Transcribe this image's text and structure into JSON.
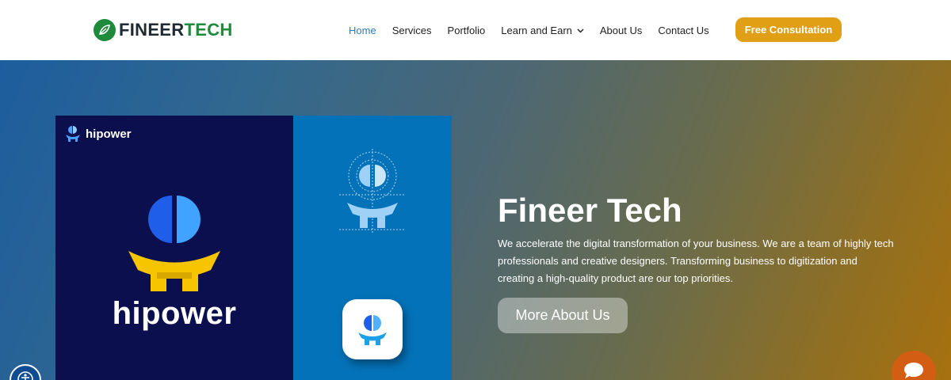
{
  "brand": {
    "logo_part1": "FINEER",
    "logo_part2": "TECH",
    "icon": "leaf-logo-icon"
  },
  "nav": {
    "items": [
      {
        "label": "Home",
        "active": true
      },
      {
        "label": "Services"
      },
      {
        "label": "Portfolio"
      },
      {
        "label": "Learn and Earn",
        "has_dropdown": true,
        "icon": "chevron-down-icon"
      },
      {
        "label": "About Us"
      },
      {
        "label": "Contact Us"
      }
    ],
    "cta_label": "Free Consultation"
  },
  "hero": {
    "artwork": {
      "brand_small": "hipower",
      "brand_large": "hipower"
    },
    "title": "Fineer Tech",
    "text": "We accelerate the digital transformation of your business. We are a team of highly tech professionals and creative designers. Transforming business to digitization and creating a high-quality product are our top priorities.",
    "button_label": "More About Us"
  },
  "widgets": {
    "chat_icon": "chat-bubble-icon",
    "accessibility_icon": "accessibility-icon"
  },
  "colors": {
    "accent": "#e09f14",
    "brand_green": "#1e8a3c",
    "nav_active": "#2b7cc1",
    "chat": "#d35d13"
  }
}
